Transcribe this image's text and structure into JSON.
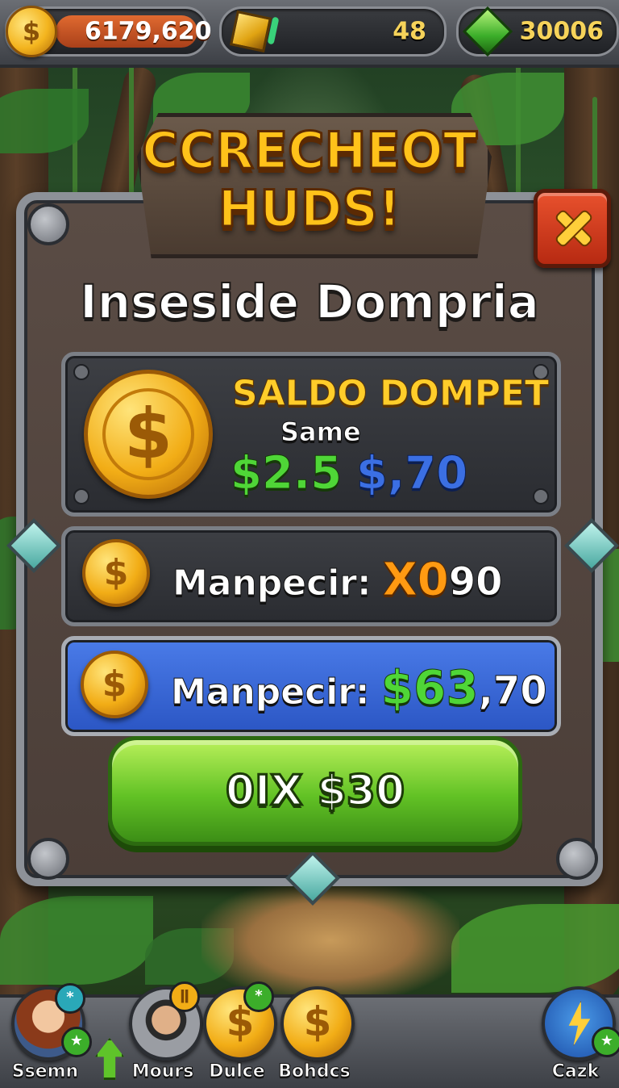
{
  "resources": {
    "gold": {
      "value": "6179,620",
      "icon": "dollar-coin-icon"
    },
    "gems": {
      "value": "48",
      "icon": "yellow-gem-icon"
    },
    "emeralds": {
      "value": "30006",
      "icon": "green-gem-icon"
    }
  },
  "banner": {
    "line1": "CCRECHEOT",
    "line2": "HUDS!"
  },
  "dialog": {
    "title": "Inseside Dompria",
    "balance_card": {
      "heading": "SALDO DOMPET",
      "subheading": "Same",
      "amount_green": "$2.5",
      "amount_blue": "$,70"
    },
    "row1": {
      "label": "Manpecir:",
      "value_orange": "X0",
      "value_white": "90"
    },
    "row2": {
      "label": "Manpecir:",
      "value_green": "$63",
      "value_white": ",70"
    },
    "action_button": "0IX $30"
  },
  "bottom_nav": [
    {
      "label": "Ssemn",
      "icon": "hero-avatar-icon"
    },
    {
      "label": "Mours",
      "icon": "mustache-man-icon"
    },
    {
      "label": "Dulce",
      "icon": "coin-icon"
    },
    {
      "label": "Bohdcs",
      "icon": "coin-icon"
    },
    {
      "label": "Cazk",
      "icon": "lightning-icon"
    }
  ],
  "colors": {
    "accent_green": "#4fd637",
    "accent_gold": "#ffcd2a",
    "panel_blue": "#2b56c4",
    "close_red": "#d23e1e"
  }
}
